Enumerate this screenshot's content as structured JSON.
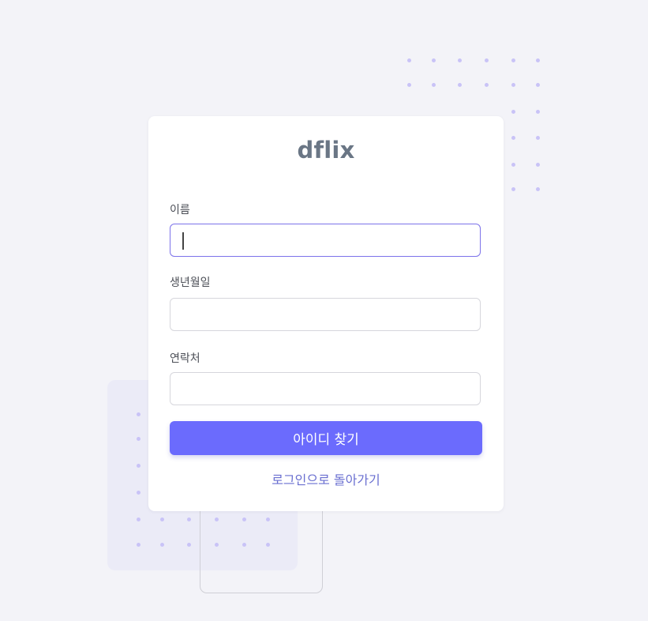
{
  "app": {
    "logo": "dflix"
  },
  "form": {
    "name_label": "이름",
    "name_value": "",
    "birth_label": "생년월일",
    "birth_value": "",
    "phone_label": "연락처",
    "phone_value": "",
    "submit_label": "아이디 찾기",
    "back_link_label": "로그인으로 돌아가기"
  },
  "colors": {
    "background": "#f3f3f8",
    "primary": "#6b6bfd",
    "link": "#6a6fd0",
    "logo": "#6a7685",
    "focus_border": "#7c72ea",
    "decor_dot": "#c9c3f7"
  },
  "focused_field": "name"
}
